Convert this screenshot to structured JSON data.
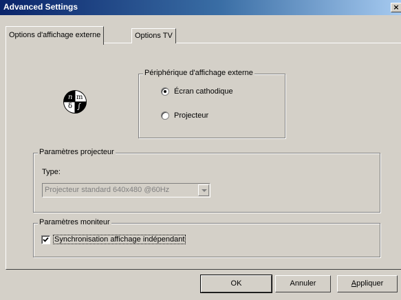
{
  "window": {
    "title": "Advanced Settings",
    "close_glyph": "×"
  },
  "tabs": [
    {
      "label": "Options d'affichage externe",
      "active": true
    },
    {
      "label": "Options TV",
      "active": false
    }
  ],
  "display_icon": {
    "name": "display-math-icon",
    "glyphs": [
      "n",
      "m",
      "δ",
      "∫"
    ]
  },
  "external_display": {
    "legend": "Périphérique d'affichage externe",
    "options": [
      {
        "label": "Écran cathodique",
        "selected": true
      },
      {
        "label": "Projecteur",
        "selected": false
      }
    ]
  },
  "projector_params": {
    "legend": "Paramètres projecteur",
    "type_label": "Type:",
    "type_value": "Projecteur standard 640x480 @60Hz",
    "disabled": true
  },
  "monitor_params": {
    "legend": "Paramètres moniteur",
    "sync_label": "Synchronisation affichage indépendant",
    "sync_checked": true
  },
  "buttons": {
    "ok": "OK",
    "cancel": "Annuler",
    "apply": "Appliquer"
  }
}
